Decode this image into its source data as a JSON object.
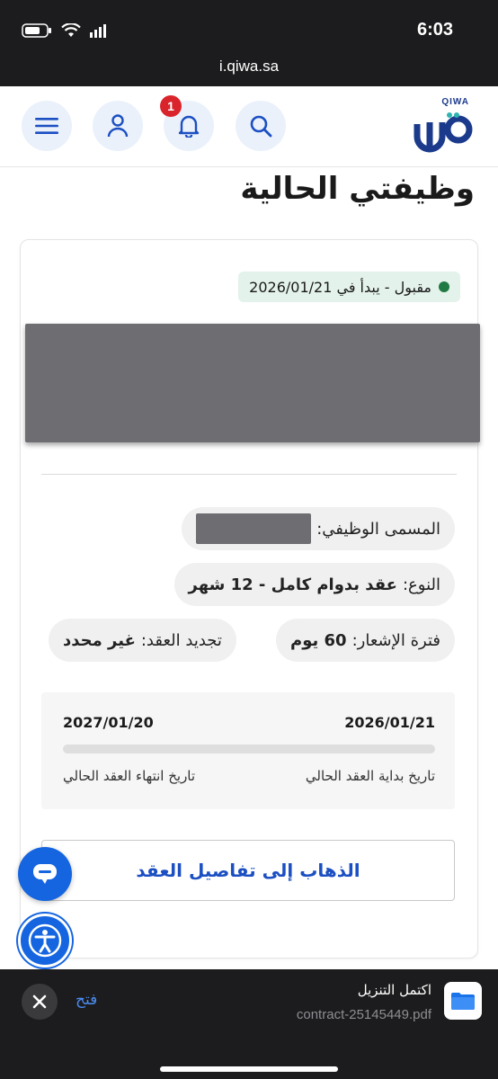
{
  "status_bar": {
    "time": "6:03"
  },
  "browser": {
    "url": "i.qiwa.sa"
  },
  "header": {
    "logo_small_text": "QIWA",
    "notification_count": "1",
    "icons": [
      "menu-icon",
      "user-icon",
      "bell-icon",
      "search-icon"
    ]
  },
  "page": {
    "title": "وظيفتي الحالية"
  },
  "contract": {
    "status_text": "مقبول - يبدأ في 2026/01/21",
    "status_color": "#1f7a43",
    "job_title_label": "المسمى الوظيفي:",
    "type_label": "النوع:",
    "type_value": "عقد بدوام كامل - 12 شهر",
    "notice_label": "فترة الإشعار:",
    "notice_value": "60 يوم",
    "renewal_label": "تجديد العقد:",
    "renewal_value": "غير محدد",
    "start_date": "2026/01/21",
    "end_date": "2027/01/20",
    "start_label": "تاريخ بداية العقد الحالي",
    "end_label": "تاريخ انتهاء العقد الحالي",
    "progress": 0,
    "details_button": "الذهاب إلى تفاصيل العقد"
  },
  "download": {
    "title": "اكتمل التنزيل",
    "file": "contract-25145449.pdf",
    "open_label": "فتح"
  },
  "colors": {
    "accent": "#1b4fc2",
    "brand": "#1b3a8c",
    "badge": "#d9242c"
  }
}
